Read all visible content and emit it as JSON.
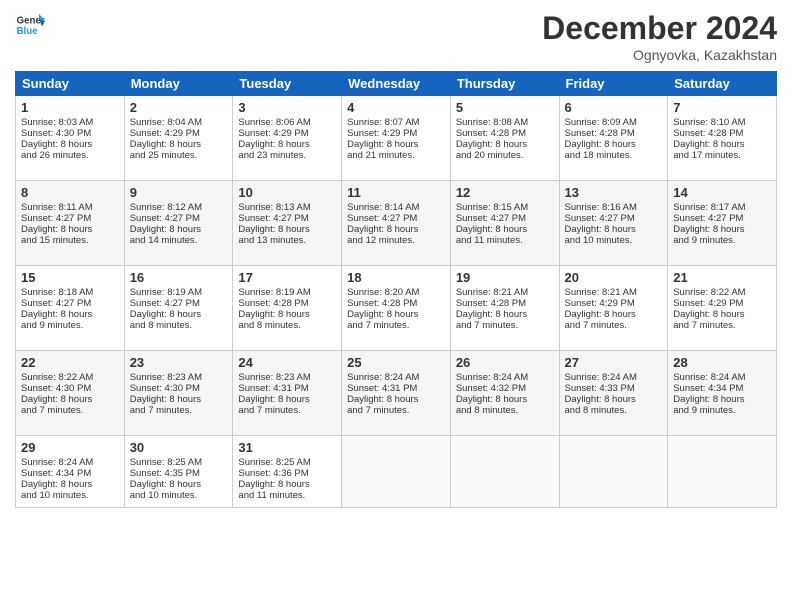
{
  "header": {
    "logo_line1": "General",
    "logo_line2": "Blue",
    "month": "December 2024",
    "location": "Ognyovka, Kazakhstan"
  },
  "weekdays": [
    "Sunday",
    "Monday",
    "Tuesday",
    "Wednesday",
    "Thursday",
    "Friday",
    "Saturday"
  ],
  "weeks": [
    [
      {
        "day": "1",
        "lines": [
          "Sunrise: 8:03 AM",
          "Sunset: 4:30 PM",
          "Daylight: 8 hours",
          "and 26 minutes."
        ]
      },
      {
        "day": "2",
        "lines": [
          "Sunrise: 8:04 AM",
          "Sunset: 4:29 PM",
          "Daylight: 8 hours",
          "and 25 minutes."
        ]
      },
      {
        "day": "3",
        "lines": [
          "Sunrise: 8:06 AM",
          "Sunset: 4:29 PM",
          "Daylight: 8 hours",
          "and 23 minutes."
        ]
      },
      {
        "day": "4",
        "lines": [
          "Sunrise: 8:07 AM",
          "Sunset: 4:29 PM",
          "Daylight: 8 hours",
          "and 21 minutes."
        ]
      },
      {
        "day": "5",
        "lines": [
          "Sunrise: 8:08 AM",
          "Sunset: 4:28 PM",
          "Daylight: 8 hours",
          "and 20 minutes."
        ]
      },
      {
        "day": "6",
        "lines": [
          "Sunrise: 8:09 AM",
          "Sunset: 4:28 PM",
          "Daylight: 8 hours",
          "and 18 minutes."
        ]
      },
      {
        "day": "7",
        "lines": [
          "Sunrise: 8:10 AM",
          "Sunset: 4:28 PM",
          "Daylight: 8 hours",
          "and 17 minutes."
        ]
      }
    ],
    [
      {
        "day": "8",
        "lines": [
          "Sunrise: 8:11 AM",
          "Sunset: 4:27 PM",
          "Daylight: 8 hours",
          "and 15 minutes."
        ]
      },
      {
        "day": "9",
        "lines": [
          "Sunrise: 8:12 AM",
          "Sunset: 4:27 PM",
          "Daylight: 8 hours",
          "and 14 minutes."
        ]
      },
      {
        "day": "10",
        "lines": [
          "Sunrise: 8:13 AM",
          "Sunset: 4:27 PM",
          "Daylight: 8 hours",
          "and 13 minutes."
        ]
      },
      {
        "day": "11",
        "lines": [
          "Sunrise: 8:14 AM",
          "Sunset: 4:27 PM",
          "Daylight: 8 hours",
          "and 12 minutes."
        ]
      },
      {
        "day": "12",
        "lines": [
          "Sunrise: 8:15 AM",
          "Sunset: 4:27 PM",
          "Daylight: 8 hours",
          "and 11 minutes."
        ]
      },
      {
        "day": "13",
        "lines": [
          "Sunrise: 8:16 AM",
          "Sunset: 4:27 PM",
          "Daylight: 8 hours",
          "and 10 minutes."
        ]
      },
      {
        "day": "14",
        "lines": [
          "Sunrise: 8:17 AM",
          "Sunset: 4:27 PM",
          "Daylight: 8 hours",
          "and 9 minutes."
        ]
      }
    ],
    [
      {
        "day": "15",
        "lines": [
          "Sunrise: 8:18 AM",
          "Sunset: 4:27 PM",
          "Daylight: 8 hours",
          "and 9 minutes."
        ]
      },
      {
        "day": "16",
        "lines": [
          "Sunrise: 8:19 AM",
          "Sunset: 4:27 PM",
          "Daylight: 8 hours",
          "and 8 minutes."
        ]
      },
      {
        "day": "17",
        "lines": [
          "Sunrise: 8:19 AM",
          "Sunset: 4:28 PM",
          "Daylight: 8 hours",
          "and 8 minutes."
        ]
      },
      {
        "day": "18",
        "lines": [
          "Sunrise: 8:20 AM",
          "Sunset: 4:28 PM",
          "Daylight: 8 hours",
          "and 7 minutes."
        ]
      },
      {
        "day": "19",
        "lines": [
          "Sunrise: 8:21 AM",
          "Sunset: 4:28 PM",
          "Daylight: 8 hours",
          "and 7 minutes."
        ]
      },
      {
        "day": "20",
        "lines": [
          "Sunrise: 8:21 AM",
          "Sunset: 4:29 PM",
          "Daylight: 8 hours",
          "and 7 minutes."
        ]
      },
      {
        "day": "21",
        "lines": [
          "Sunrise: 8:22 AM",
          "Sunset: 4:29 PM",
          "Daylight: 8 hours",
          "and 7 minutes."
        ]
      }
    ],
    [
      {
        "day": "22",
        "lines": [
          "Sunrise: 8:22 AM",
          "Sunset: 4:30 PM",
          "Daylight: 8 hours",
          "and 7 minutes."
        ]
      },
      {
        "day": "23",
        "lines": [
          "Sunrise: 8:23 AM",
          "Sunset: 4:30 PM",
          "Daylight: 8 hours",
          "and 7 minutes."
        ]
      },
      {
        "day": "24",
        "lines": [
          "Sunrise: 8:23 AM",
          "Sunset: 4:31 PM",
          "Daylight: 8 hours",
          "and 7 minutes."
        ]
      },
      {
        "day": "25",
        "lines": [
          "Sunrise: 8:24 AM",
          "Sunset: 4:31 PM",
          "Daylight: 8 hours",
          "and 7 minutes."
        ]
      },
      {
        "day": "26",
        "lines": [
          "Sunrise: 8:24 AM",
          "Sunset: 4:32 PM",
          "Daylight: 8 hours",
          "and 8 minutes."
        ]
      },
      {
        "day": "27",
        "lines": [
          "Sunrise: 8:24 AM",
          "Sunset: 4:33 PM",
          "Daylight: 8 hours",
          "and 8 minutes."
        ]
      },
      {
        "day": "28",
        "lines": [
          "Sunrise: 8:24 AM",
          "Sunset: 4:34 PM",
          "Daylight: 8 hours",
          "and 9 minutes."
        ]
      }
    ],
    [
      {
        "day": "29",
        "lines": [
          "Sunrise: 8:24 AM",
          "Sunset: 4:34 PM",
          "Daylight: 8 hours",
          "and 10 minutes."
        ]
      },
      {
        "day": "30",
        "lines": [
          "Sunrise: 8:25 AM",
          "Sunset: 4:35 PM",
          "Daylight: 8 hours",
          "and 10 minutes."
        ]
      },
      {
        "day": "31",
        "lines": [
          "Sunrise: 8:25 AM",
          "Sunset: 4:36 PM",
          "Daylight: 8 hours",
          "and 11 minutes."
        ]
      },
      null,
      null,
      null,
      null
    ]
  ]
}
